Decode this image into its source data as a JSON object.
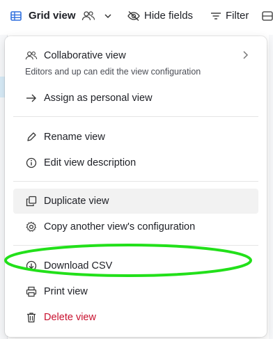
{
  "toolbar": {
    "grid_view_label": "Grid view",
    "hide_fields_label": "Hide fields",
    "filter_label": "Filter"
  },
  "menu": {
    "collaborative_label": "Collaborative view",
    "collaborative_desc": "Editors and up can edit the view configuration",
    "assign_personal_label": "Assign as personal view",
    "rename_label": "Rename view",
    "edit_description_label": "Edit view description",
    "duplicate_label": "Duplicate view",
    "copy_config_label": "Copy another view's configuration",
    "download_csv_label": "Download CSV",
    "print_label": "Print view",
    "delete_label": "Delete view"
  },
  "colors": {
    "accent": "#1a73e8",
    "danger": "#c8102e",
    "annotation": "#22e01a"
  }
}
